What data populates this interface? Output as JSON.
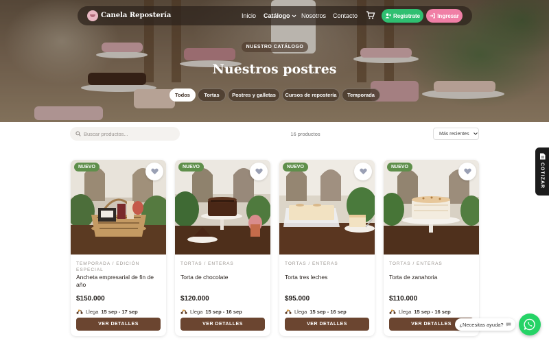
{
  "nav": {
    "brand": "Canela Repostería",
    "links": [
      "Inicio",
      "Catálogo",
      "Nosotros",
      "Contacto"
    ],
    "register_label": "Registrate",
    "login_label": "Ingresar"
  },
  "hero": {
    "eyebrow": "NUESTRO CATÁLOGO",
    "title": "Nuestros postres",
    "filters": [
      "Todos",
      "Tortas",
      "Postres y galletas",
      "Cursos de repostería",
      "Temporada"
    ],
    "active_filter": "Todos"
  },
  "toolbar": {
    "search_placeholder": "Buscar productos...",
    "count": "16 productos",
    "sort_value": "Más recientes"
  },
  "products": [
    {
      "badge": "NUEVO",
      "category": "TEMPORADA / EDICIÓN ESPECIAL",
      "name": "Ancheta empresarial de fin de año",
      "price": "$150.000",
      "ship_prefix": "Llega",
      "ship_dates": "15 sep - 17 sep",
      "button": "VER DETALLES"
    },
    {
      "badge": "NUEVO",
      "category": "TORTAS / ENTERAS",
      "name": "Torta de chocolate",
      "price": "$120.000",
      "ship_prefix": "Llega",
      "ship_dates": "15 sep - 16 sep",
      "button": "VER DETALLES"
    },
    {
      "badge": "NUEVO",
      "category": "TORTAS / ENTERAS",
      "name": "Torta tres leches",
      "price": "$95.000",
      "ship_prefix": "Llega",
      "ship_dates": "15 sep - 16 sep",
      "button": "VER DETALLES"
    },
    {
      "badge": "NUEVO",
      "category": "TORTAS / ENTERAS",
      "name": "Torta de zanahoria",
      "price": "$110.000",
      "ship_prefix": "Llega",
      "ship_dates": "15 sep - 16 sep",
      "button": "VER DETALLES"
    }
  ],
  "side_tab": "COTIZAR",
  "help_label": "¿Necesitas ayuda?",
  "colors": {
    "brand_brown": "#6b4530",
    "register_green": "#2fbf71",
    "login_pink": "#f07fa6",
    "badge_green": "#5f8f4b",
    "whatsapp": "#25d366"
  }
}
